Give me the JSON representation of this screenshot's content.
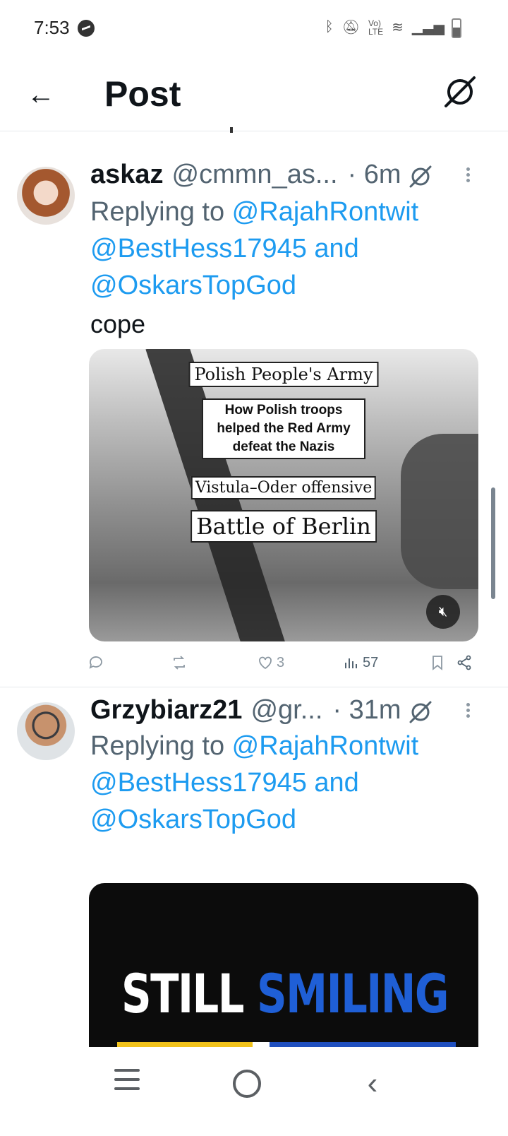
{
  "status_bar": {
    "time": "7:53",
    "icons": [
      "messenger-icon",
      "bluetooth-icon",
      "mute-icon",
      "volte-icon",
      "wifi-icon",
      "signal-icon",
      "battery-icon"
    ]
  },
  "header": {
    "title": "Post",
    "back_icon": "arrow-left-icon",
    "right_icon": "grok-icon"
  },
  "tweets": [
    {
      "display_name": "askaz",
      "handle": "@cmmn_as...",
      "time": "· 6m",
      "reply_prefix": "Replying to ",
      "mention_1": "@RajahRontwit",
      "mention_2": "@BestHess17945",
      "and": " and",
      "mention_3": "@OskarsTopGod",
      "text": "cope",
      "media": {
        "caption_1": "Polish People's Army",
        "caption_2": "How Polish troops helped the Red Army defeat the Nazis",
        "caption_3": "Vistula–Oder offensive",
        "caption_4": "Battle of Berlin",
        "mute_icon": "speaker-muted-icon"
      },
      "actions": {
        "reply_count": "",
        "retweet_count": "",
        "like_count": "3",
        "view_count": "57"
      }
    },
    {
      "display_name": "Grzybiarz21",
      "handle": "@gr...",
      "time": "· 31m",
      "reply_prefix": "Replying to ",
      "mention_1": "@RajahRontwit",
      "mention_2": "@BestHess17945",
      "and": " and",
      "mention_3": "@OskarsTopGod",
      "media": {
        "text_a": "STILL",
        "text_b": "SMILING"
      }
    }
  ],
  "nav_bar": {
    "icons": [
      "recent-apps-icon",
      "home-icon",
      "back-icon"
    ]
  },
  "colors": {
    "link": "#1d9bf0",
    "secondary_text": "#536471",
    "primary_text": "#0f1419"
  }
}
